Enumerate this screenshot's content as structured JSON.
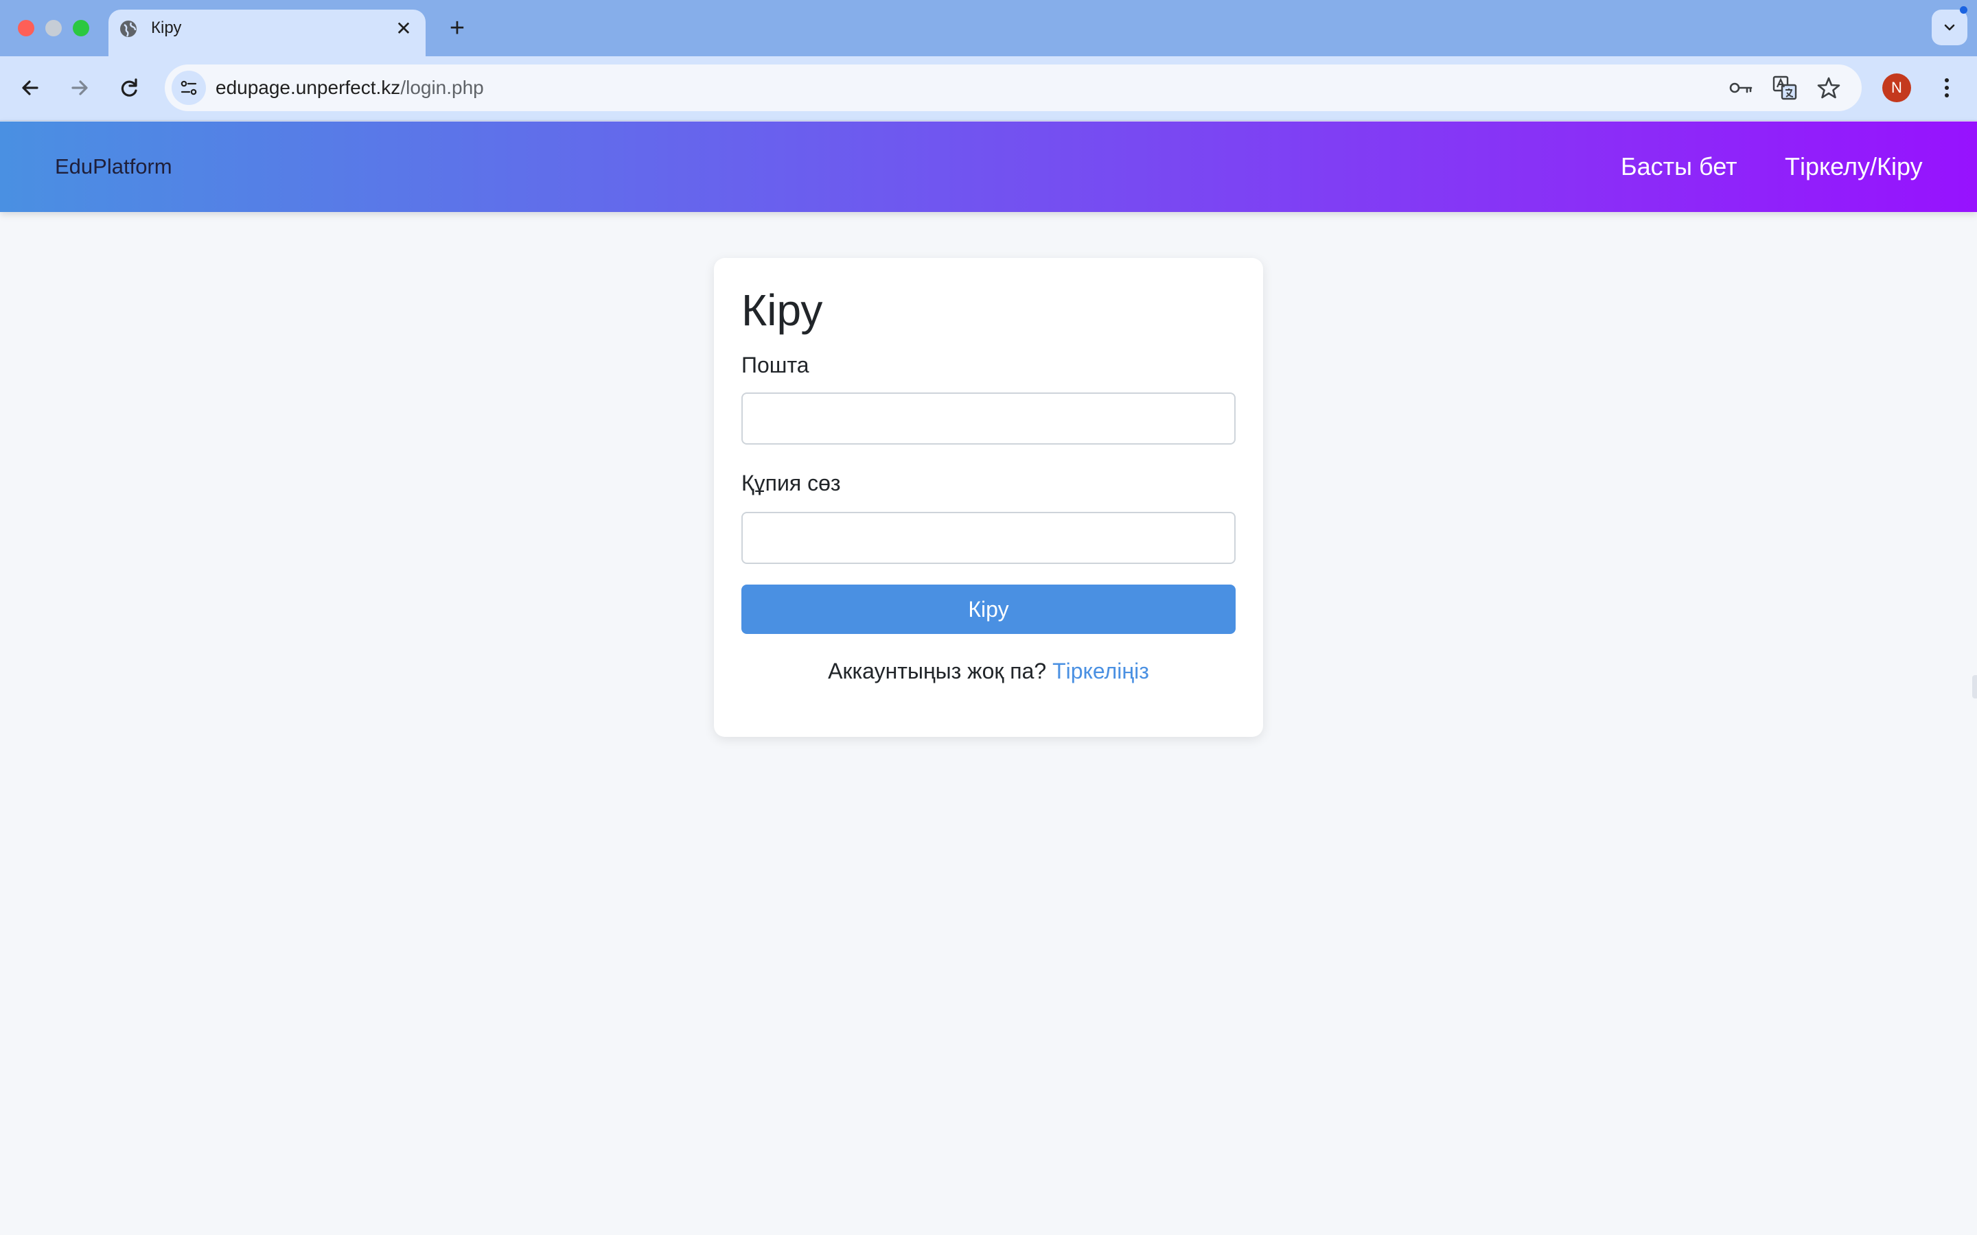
{
  "browser": {
    "tab_title": "Кіру",
    "new_tab_symbol": "+",
    "close_symbol": "✕",
    "url_host": "edupage.unperfect.kz",
    "url_path": "/login.php",
    "profile_initial": "N"
  },
  "site": {
    "brand": "EduPlatform",
    "nav": {
      "home": "Басты бет",
      "auth": "Тіркелу/Кіру"
    },
    "gradient_colors": [
      "#4a90e2",
      "#9712fe"
    ]
  },
  "login": {
    "title": "Кіру",
    "email_label": "Пошта",
    "email_value": "",
    "password_label": "Құпия сөз",
    "password_value": "",
    "submit_label": "Кіру",
    "no_account_text": "Аккаунтыңыз жоқ па?",
    "register_link": "Тіркеліңіз",
    "accent_color": "#4a90e2"
  }
}
